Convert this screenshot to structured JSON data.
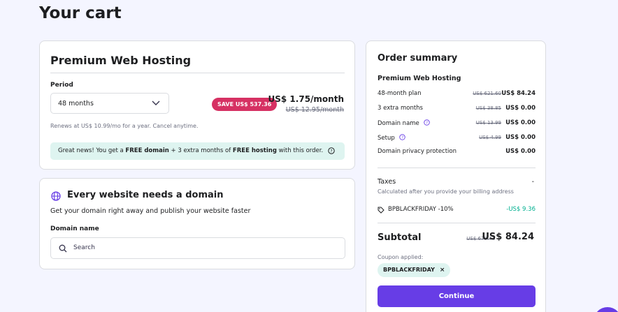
{
  "page": {
    "title": "Your cart"
  },
  "hosting": {
    "title": "Premium Web Hosting",
    "period_label": "Period",
    "period_value": "48 months",
    "save_badge": "SAVE US$ 537.36",
    "price": "US$ 1.75/month",
    "old_price": "US$ 12.95/month",
    "renews": "Renews at US$ 10.99/mo for a year. Cancel anytime.",
    "promo_parts": [
      "Great news! You get a ",
      "FREE domain",
      " + 3 extra months of ",
      "FREE hosting",
      " with this order."
    ]
  },
  "domain": {
    "title": "Every website needs a domain",
    "subtitle": "Get your domain right away and publish your website faster",
    "field_label": "Domain name",
    "search_placeholder": "Search"
  },
  "summary": {
    "title": "Order summary",
    "product": "Premium Web Hosting",
    "rows": [
      {
        "label": "48-month plan",
        "old": "US$ 621.60",
        "value": "US$ 84.24",
        "help": false
      },
      {
        "label": "3 extra months",
        "old": "US$ 38.85",
        "value": "US$ 0.00",
        "help": false
      },
      {
        "label": "Domain name",
        "old": "US$ 13.99",
        "value": "US$ 0.00",
        "help": true
      },
      {
        "label": "Setup",
        "old": "US$ 4.99",
        "value": "US$ 0.00",
        "help": true
      },
      {
        "label": "Domain privacy protection",
        "old": "",
        "value": "US$ 0.00",
        "help": false
      }
    ],
    "taxes_label": "Taxes",
    "taxes_value": "-",
    "taxes_note": "Calculated after you provide your billing address",
    "coupon_name": "BPBLACKFRIDAY -10%",
    "coupon_value": "-US$ 9.36",
    "subtotal_label": "Subtotal",
    "subtotal_old": "US$ 679.43",
    "subtotal_value": "US$ 84.24",
    "coupon_applied_label": "Coupon applied:",
    "coupon_chip": "BPBLACKFRIDAY",
    "coupon_remove": "×",
    "continue_label": "Continue"
  },
  "colors": {
    "accent": "#673de6",
    "badge": "#d63163",
    "success": "#00b090",
    "promo_bg": "#def4f0"
  }
}
